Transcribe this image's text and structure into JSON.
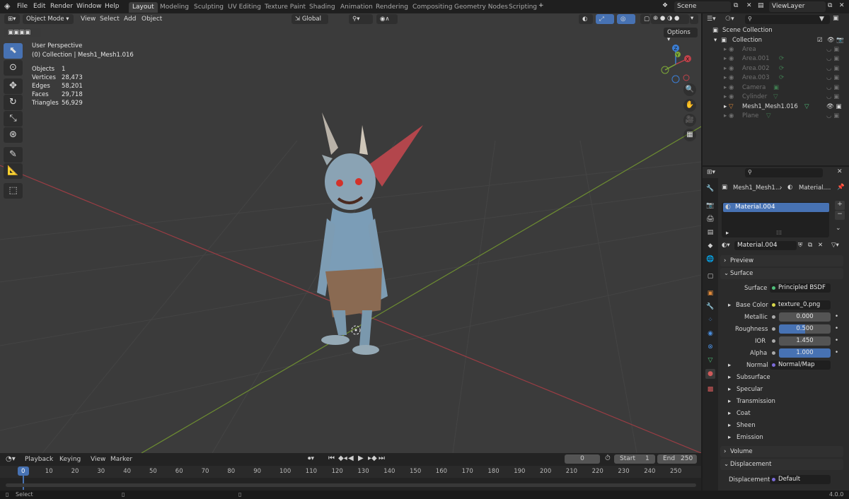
{
  "menu": [
    "File",
    "Edit",
    "Render",
    "Window",
    "Help"
  ],
  "workspaces": [
    "Layout",
    "Modeling",
    "Sculpting",
    "UV Editing",
    "Texture Paint",
    "Shading",
    "Animation",
    "Rendering",
    "Compositing",
    "Geometry Nodes",
    "Scripting"
  ],
  "active_workspace": "Layout",
  "scene": "Scene",
  "view_layer": "ViewLayer",
  "viewport": {
    "mode": "Object Mode",
    "menus": [
      "View",
      "Select",
      "Add",
      "Object"
    ],
    "transform": "Global",
    "options": "Options",
    "perspective": "User Perspective",
    "collection_line": "(0) Collection | Mesh1_Mesh1.016",
    "stats": [
      {
        "label": "Objects",
        "value": "1"
      },
      {
        "label": "Vertices",
        "value": "28,473"
      },
      {
        "label": "Edges",
        "value": "58,201"
      },
      {
        "label": "Faces",
        "value": "29,718"
      },
      {
        "label": "Triangles",
        "value": "56,929"
      }
    ],
    "gizmo": {
      "x": "X",
      "y": "Y",
      "z": "Z"
    }
  },
  "outliner": {
    "root": "Scene Collection",
    "collection": "Collection",
    "items": [
      "Area",
      "Area.001",
      "Area.002",
      "Area.003",
      "Camera",
      "Cylinder",
      "Mesh1_Mesh1.016",
      "Plane"
    ]
  },
  "properties": {
    "breadcrumb_object": "Mesh1_Mesh1...",
    "breadcrumb_material": "Material....",
    "material_slot": "Material.004",
    "material_name": "Material.004",
    "preview": "Preview",
    "surface_panel": "Surface",
    "surface_label": "Surface",
    "surface_value": "Principled BSDF",
    "base_color_label": "Base Color",
    "base_color_value": "texture_0.png",
    "metallic_label": "Metallic",
    "metallic_value": "0.000",
    "roughness_label": "Roughness",
    "roughness_value": "0.500",
    "roughness": 0.5,
    "ior_label": "IOR",
    "ior_value": "1.450",
    "alpha_label": "Alpha",
    "alpha_value": "1.000",
    "alpha": 1.0,
    "normal_label": "Normal",
    "normal_value": "Normal/Map",
    "subpanels": [
      "Subsurface",
      "Specular",
      "Transmission",
      "Coat",
      "Sheen",
      "Emission"
    ],
    "volume": "Volume",
    "displacement_panel": "Displacement",
    "displacement_label": "Displacement",
    "displacement_value": "Default"
  },
  "timeline": {
    "menus": [
      "Playback",
      "Keying",
      "View",
      "Marker"
    ],
    "current_frame": "0",
    "start_label": "Start",
    "start_value": "1",
    "end_label": "End",
    "end_value": "250",
    "ruler": [
      "0",
      "10",
      "20",
      "30",
      "40",
      "50",
      "60",
      "70",
      "80",
      "90",
      "100",
      "110",
      "120",
      "130",
      "140",
      "150",
      "160",
      "170",
      "180",
      "190",
      "200",
      "210",
      "220",
      "230",
      "240",
      "250"
    ]
  },
  "status": {
    "left": "Select",
    "version": "4.0.0"
  },
  "colors": {
    "accent": "#4772b3",
    "viewport": "#3b3b3b",
    "panel": "#2b2b2b",
    "x_axis": "#c0424a",
    "y_axis": "#7da838",
    "z_axis": "#3c7fd6"
  }
}
